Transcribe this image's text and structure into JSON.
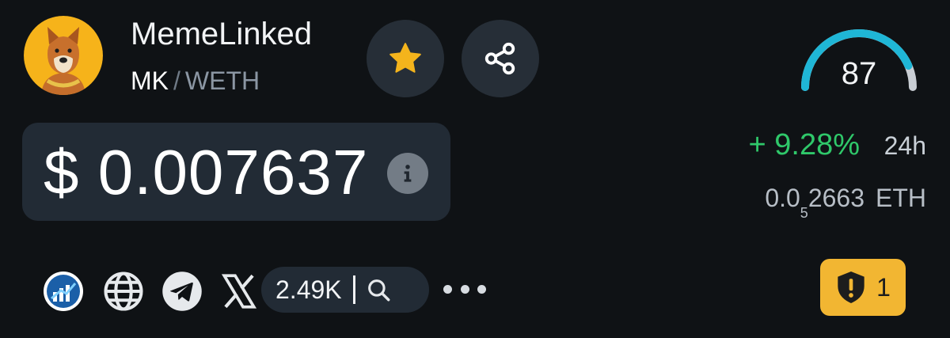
{
  "token": {
    "name": "MemeLinked",
    "symbol": "MK",
    "pair_separator": "/",
    "quote": "WETH"
  },
  "price": {
    "usd_display": "$ 0.007637",
    "change_24h": "+ 9.28%",
    "change_period": "24h",
    "eth_prefix": "0.0",
    "eth_zero_count": "5",
    "eth_digits": "2663",
    "eth_unit": "ETH"
  },
  "score": {
    "value": "87",
    "max": 100
  },
  "social": {
    "x_followers": "2.49K"
  },
  "alerts": {
    "count": "1"
  },
  "colors": {
    "background": "#0f1215",
    "card": "#222b35",
    "button": "#262e37",
    "positive": "#2fc86a",
    "star": "#f4b41c",
    "gauge": "#1fb6d6",
    "alert": "#f2b632"
  },
  "icons": {
    "favorite": "star-icon",
    "share": "share-icon",
    "info": "info-icon",
    "chart": "chart-logo-icon",
    "website": "globe-icon",
    "telegram": "telegram-icon",
    "x": "x-icon",
    "search": "search-icon",
    "more": "more-icon",
    "alert": "shield-alert-icon"
  }
}
